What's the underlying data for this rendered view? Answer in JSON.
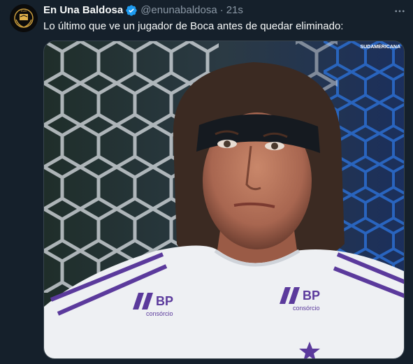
{
  "tweet": {
    "author_name": "En Una Baldosa",
    "handle": "@enunabaldosa",
    "separator": "·",
    "time": "21s",
    "text": "Lo último que ve un jugador de Boca antes de quedar eliminado:",
    "verified": true
  },
  "media": {
    "watermark": "SUDAMERICANA",
    "sponsor_logo_left": "BP",
    "sponsor_sub_left": "consórcio",
    "sponsor_logo_right": "BP",
    "sponsor_sub_right": "consórcio"
  },
  "icons": {
    "verified": "verified-badge-icon",
    "more": "more-dots-icon"
  },
  "colors": {
    "background": "#15202b",
    "verified_blue": "#1d9bf0",
    "muted_text": "#8b98a5",
    "jersey_purple": "#5b3a9c"
  }
}
